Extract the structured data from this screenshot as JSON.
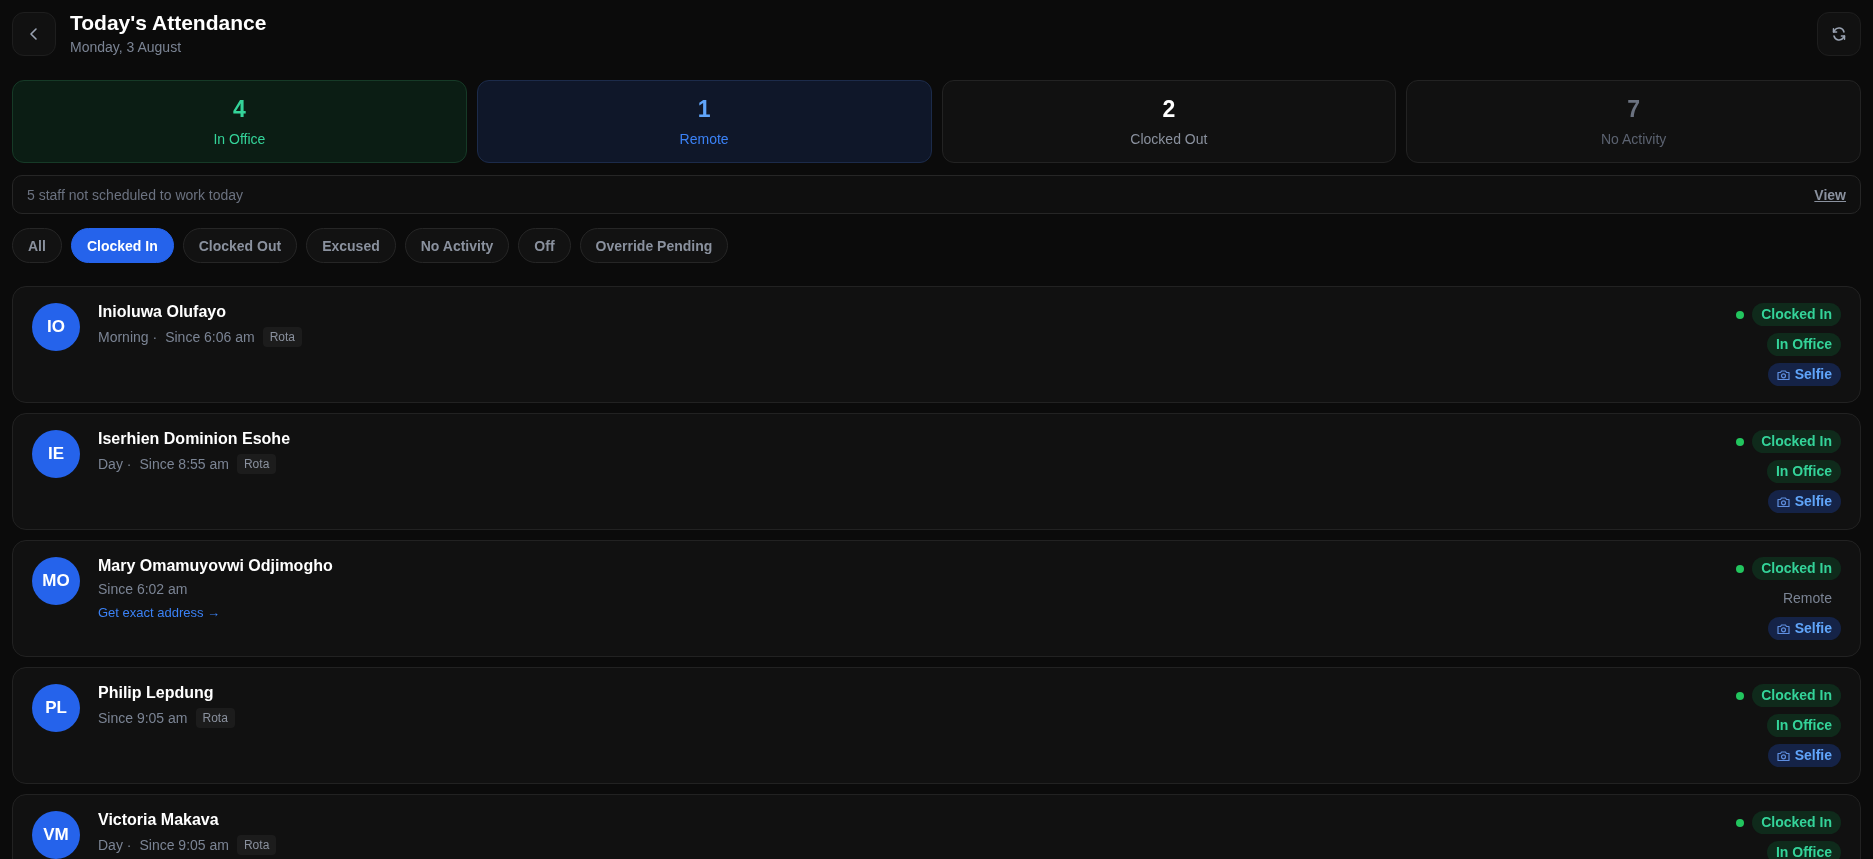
{
  "header": {
    "title": "Today's Attendance",
    "date": "Monday, 3 August"
  },
  "stats": [
    {
      "value": "4",
      "label": "In Office",
      "kind": "green"
    },
    {
      "value": "1",
      "label": "Remote",
      "kind": "blue"
    },
    {
      "value": "2",
      "label": "Clocked Out",
      "kind": "white"
    },
    {
      "value": "7",
      "label": "No Activity",
      "kind": "gray"
    }
  ],
  "notice": {
    "text": "5 staff not scheduled to work today",
    "link": "View"
  },
  "filters": [
    {
      "label": "All",
      "selected": false
    },
    {
      "label": "Clocked In",
      "selected": true
    },
    {
      "label": "Clocked Out",
      "selected": false
    },
    {
      "label": "Excused",
      "selected": false
    },
    {
      "label": "No Activity",
      "selected": false
    },
    {
      "label": "Off",
      "selected": false
    },
    {
      "label": "Override Pending",
      "selected": false
    }
  ],
  "staff": [
    {
      "initials": "IO",
      "name": "Inioluwa Olufayo",
      "shift": "Morning ·",
      "since": "Since 6:06 am",
      "tag": "Rota",
      "status": "Clocked In",
      "location": {
        "text": "In Office",
        "kind": "office"
      },
      "selfie": "Selfie"
    },
    {
      "initials": "IE",
      "name": "Iserhien Dominion Esohe",
      "shift": "Day ·",
      "since": "Since 8:55 am",
      "tag": "Rota",
      "status": "Clocked In",
      "location": {
        "text": "In Office",
        "kind": "office"
      },
      "selfie": "Selfie"
    },
    {
      "initials": "MO",
      "name": "Mary Omamuyovwi Odjimogho",
      "since": "Since 6:02 am",
      "link": "Get exact address →",
      "status": "Clocked In",
      "location": {
        "text": "Remote",
        "kind": "remote"
      },
      "selfie": "Selfie"
    },
    {
      "initials": "PL",
      "name": "Philip Lepdung",
      "since": "Since 9:05 am",
      "tag": "Rota",
      "status": "Clocked In",
      "location": {
        "text": "In Office",
        "kind": "office"
      },
      "selfie": "Selfie"
    },
    {
      "initials": "VM",
      "name": "Victoria Makava",
      "shift": "Day ·",
      "since": "Since 9:05 am",
      "tag": "Rota",
      "status": "Clocked In",
      "location": {
        "text": "In Office",
        "kind": "office"
      }
    }
  ]
}
